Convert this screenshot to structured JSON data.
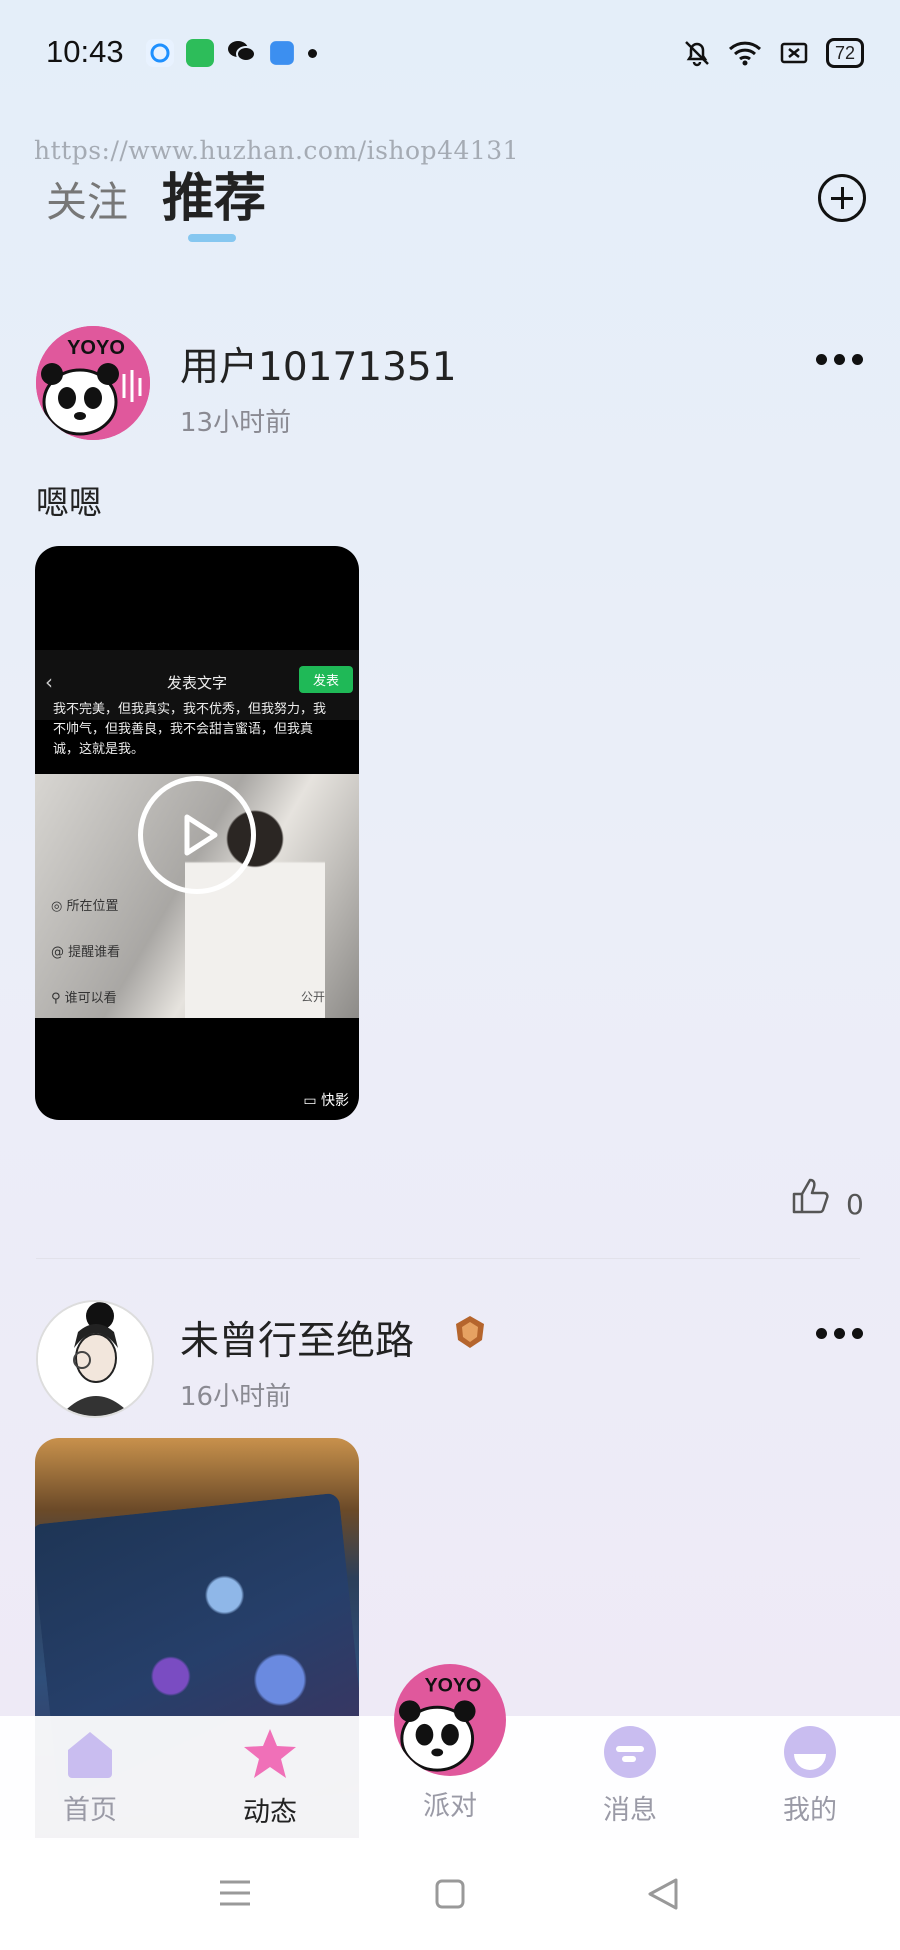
{
  "status_bar": {
    "time": "10:43",
    "battery": "72"
  },
  "watermark": "https://www.huzhan.com/ishop44131",
  "header": {
    "tabs": [
      {
        "label": "关注"
      },
      {
        "label": "推荐"
      }
    ]
  },
  "posts": [
    {
      "username": "用户10171351",
      "time": "13小时前",
      "text": "嗯嗯",
      "avatar_text": "YOYO",
      "media": {
        "type": "video",
        "screen_title": "发表文字",
        "publish_label": "发表",
        "caption": "我不完美，但我真实，我不优秀，但我努力，我不帅气，但我善良，我不会甜言蜜语，但我真诚，这就是我。",
        "menu": [
          "所在位置",
          "提醒谁看",
          "谁可以看"
        ],
        "menu_right": "公开",
        "brand": "快影"
      },
      "likes": "0"
    },
    {
      "username": "未曾行至绝路",
      "time": "16小时前",
      "media": {
        "type": "image"
      }
    }
  ],
  "bottom_nav": [
    {
      "label": "首页",
      "active": false
    },
    {
      "label": "动态",
      "active": true
    },
    {
      "label": "派对",
      "active": false,
      "badge_text": "YOYO"
    },
    {
      "label": "消息",
      "active": false
    },
    {
      "label": "我的",
      "active": false
    }
  ],
  "colors": {
    "accent": "#86c7f0",
    "nav_purple": "#c9bdf0",
    "nav_pink": "#f070b8"
  }
}
